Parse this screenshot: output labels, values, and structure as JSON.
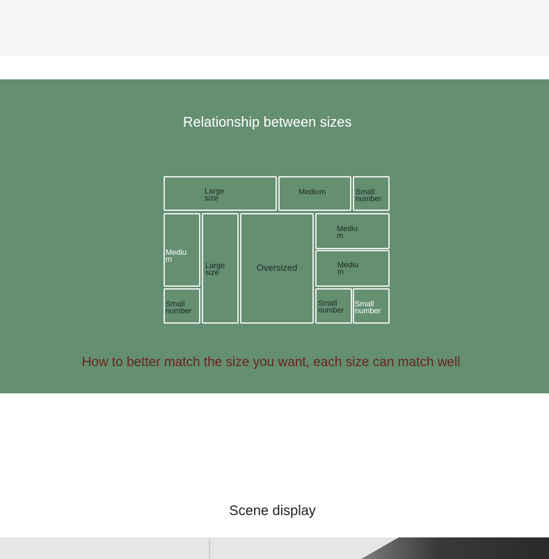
{
  "section": {
    "title": "Relationship between sizes",
    "caption": "How to better match the size you want, each size can match well"
  },
  "size_grid": {
    "cells": [
      {
        "id": "large-1",
        "label": "Large size"
      },
      {
        "id": "medium-1",
        "label": "Medium"
      },
      {
        "id": "small-1",
        "label": "Small number"
      },
      {
        "id": "medium-2",
        "label": "Mediu m"
      },
      {
        "id": "large-2",
        "label": "Large size"
      },
      {
        "id": "oversized",
        "label": "Oversized"
      },
      {
        "id": "medium-3",
        "label": "Mediu m"
      },
      {
        "id": "medium-4",
        "label": "Mediu m"
      },
      {
        "id": "small-2",
        "label": "Small number"
      },
      {
        "id": "small-3",
        "label": "Small number"
      },
      {
        "id": "small-4",
        "label": "Small number"
      }
    ]
  },
  "scene": {
    "heading": "Scene display"
  }
}
